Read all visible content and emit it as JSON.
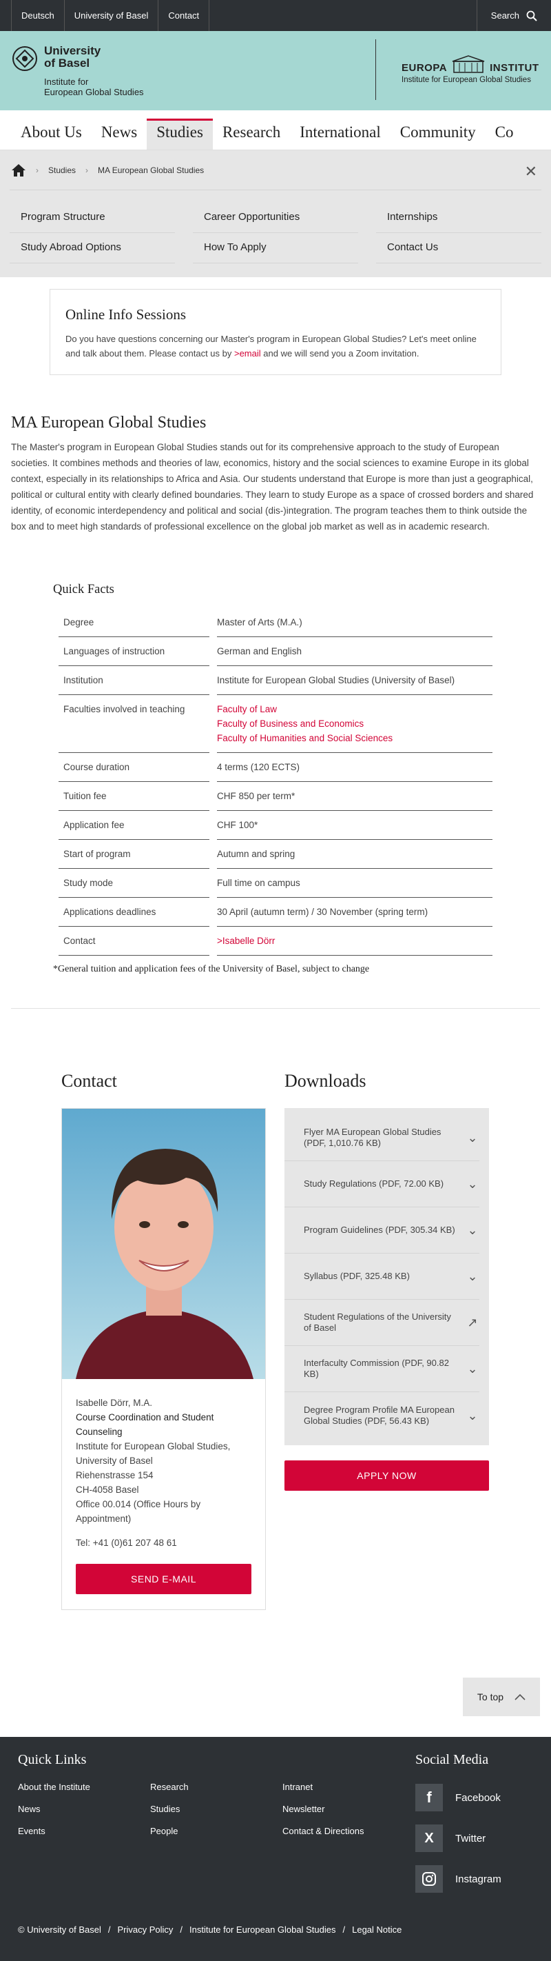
{
  "topbar": {
    "links": [
      "Deutsch",
      "University of Basel",
      "Contact"
    ],
    "search": "Search"
  },
  "brand": {
    "uni_line1": "University",
    "uni_line2": "of Basel",
    "uni_sub1": "Institute for",
    "uni_sub2": "European Global Studies",
    "europa_a": "EUROPA",
    "europa_b": "INSTITUT",
    "europa_sub": "Institute for European Global Studies"
  },
  "mainnav": [
    "About Us",
    "News",
    "Studies",
    "Research",
    "International",
    "Community",
    "Co"
  ],
  "breadcrumb": {
    "studies": "Studies",
    "current": "MA European Global Studies"
  },
  "subnav": [
    "Program Structure",
    "Career Opportunities",
    "Internships",
    "Study Abroad Options",
    "How To Apply",
    "Contact Us"
  ],
  "info": {
    "title": "Online Info Sessions",
    "text1": "Do you have questions concerning our Master's program in European Global Studies? Let's meet online and talk about them. Please contact us by ",
    "link": ">email",
    "text2": " and we will send you a Zoom invitation."
  },
  "intro": {
    "title": "MA European Global Studies",
    "text": "The Master's program in European Global Studies stands out for its comprehensive approach to the study of European societies. It combines methods and theories of law, economics, history and the social sciences to examine Europe in its global context, especially in its relationships to Africa and Asia. Our students understand that Europe is more than just a geographical, political or cultural entity with clearly defined boundaries. They learn to study Europe as a space of crossed borders and shared identity, of economic interdependency and political and social (dis-)integration. The program teaches them to think outside the box and to meet high standards of professional excellence on the global job market as well as in academic research."
  },
  "facts": {
    "title": "Quick Facts",
    "degree_k": "Degree",
    "degree_v": "Master of Arts (M.A.)",
    "lang_k": "Languages of instruction",
    "lang_v": "German and English",
    "inst_k": "Institution",
    "inst_v": "Institute for European Global Studies (University of Basel)",
    "fac_k": "Faculties involved in teaching",
    "fac_1": "Faculty of Law",
    "fac_2": "Faculty of Business and Economics",
    "fac_3": "Faculty of Humanities and Social Sciences",
    "dur_k": "Course duration",
    "dur_v": "4 terms (120 ECTS)",
    "tui_k": "Tuition fee",
    "tui_v": "CHF 850 per term*",
    "app_k": "Application fee",
    "app_v": "CHF 100*",
    "start_k": "Start of program",
    "start_v": "Autumn and spring",
    "mode_k": "Study mode",
    "mode_v": "Full time on campus",
    "dead_k": "Applications deadlines",
    "dead_v": "30 April (autumn term) / 30 November (spring term)",
    "contact_k": "Contact",
    "contact_v": ">Isabelle Dörr",
    "note": "*General tuition and application fees of the University of Basel, subject to change"
  },
  "contact": {
    "heading": "Contact",
    "name": "Isabelle Dörr, M.A.",
    "role": "Course Coordination and Student Counseling",
    "inst": "Institute for European Global Studies, University of Basel",
    "street": "Riehenstrasse 154",
    "city": "CH-4058 Basel",
    "office": "Office 00.014 (Office Hours by Appointment)",
    "tel": "Tel: +41 (0)61 207 48 61",
    "button": "SEND E-MAIL"
  },
  "downloads": {
    "heading": "Downloads",
    "items": [
      "Flyer MA European Global Studies (PDF, 1,010.76 KB)",
      "Study Regulations (PDF, 72.00 KB)",
      "Program Guidelines (PDF, 305.34 KB)",
      "Syllabus (PDF, 325.48 KB)",
      "Student Regulations of the University of Basel",
      "Interfaculty Commission (PDF, 90.82 KB)",
      "Degree Program Profile MA European Global Studies (PDF, 56.43 KB)"
    ],
    "apply": "APPLY NOW"
  },
  "totop": "To top",
  "footer": {
    "quick_title": "Quick Links",
    "links": [
      "About the Institute",
      "Research",
      "Intranet",
      "News",
      "Studies",
      "Newsletter",
      "Events",
      "People",
      "Contact & Directions"
    ],
    "social_title": "Social Media",
    "social": [
      "Facebook",
      "Twitter",
      "Instagram"
    ],
    "legal": [
      "© University of Basel",
      "Privacy Policy",
      "Institute for European Global Studies",
      "Legal Notice"
    ],
    "legal_sep": "/"
  },
  "colors": {
    "brand_red": "#d20537",
    "mint": "#a5d7d2",
    "dark": "#2d3135",
    "grey": "#e6e6e6"
  }
}
